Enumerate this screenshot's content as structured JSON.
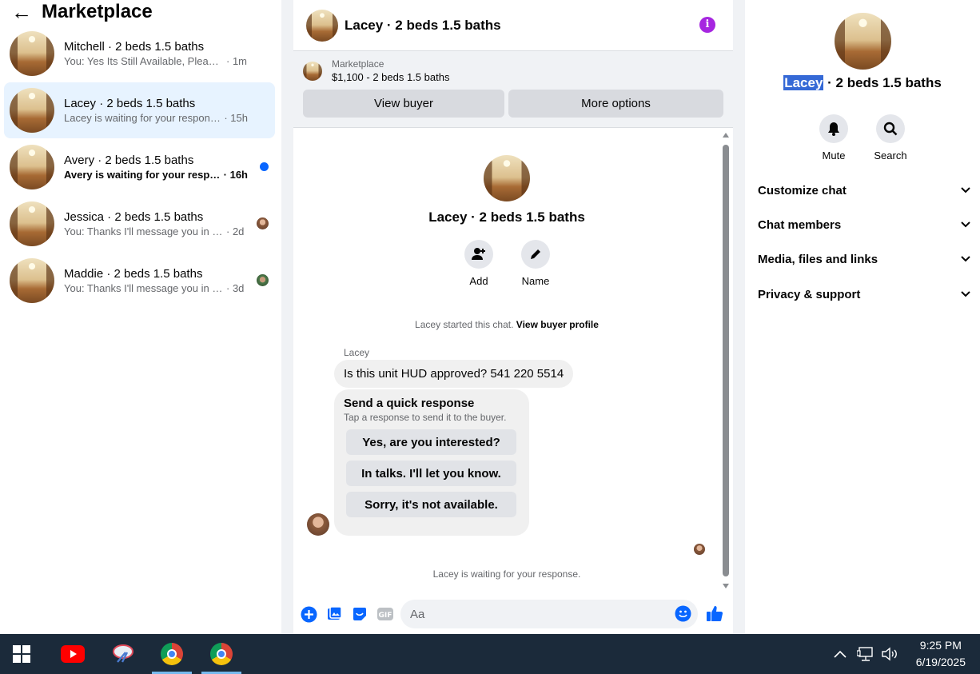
{
  "left": {
    "title": "Marketplace",
    "conversations": [
      {
        "name": "Mitchell · 2 beds 1.5 baths",
        "preview": "You: Yes Its Still Available, Please Sen...",
        "time": "· 1m"
      },
      {
        "name": "Lacey · 2 beds 1.5 baths",
        "preview": "Lacey is waiting for your response.",
        "time": "· 15h"
      },
      {
        "name": "Avery · 2 beds 1.5 baths",
        "preview": "Avery is waiting for your response.",
        "time": "· 16h"
      },
      {
        "name": "Jessica · 2 beds 1.5 baths",
        "preview": "You: Thanks I'll message you in a ...",
        "time": "· 2d"
      },
      {
        "name": "Maddie · 2 beds 1.5 baths",
        "preview": "You: Thanks I'll message you in a ...",
        "time": "· 3d"
      }
    ]
  },
  "chat": {
    "title": "Lacey · 2 beds 1.5 baths",
    "marketplace_label": "Marketplace",
    "listing": "$1,100 - 2 beds 1.5 baths",
    "view_buyer": "View buyer",
    "more_options": "More options",
    "intro_name": "Lacey · 2 beds 1.5 baths",
    "add_label": "Add",
    "name_label": "Name",
    "started_text": "Lacey started this chat.",
    "view_profile": "View buyer profile",
    "sender": "Lacey",
    "message": "Is this unit HUD approved? 541 220 5514",
    "quick_title": "Send a quick response",
    "quick_sub": "Tap a response to send it to the buyer.",
    "quick_responses": [
      "Yes, are you interested?",
      "In talks. I'll let you know.",
      "Sorry, it's not available."
    ],
    "waiting": "Lacey is waiting for your response.",
    "input_placeholder": "Aa"
  },
  "details": {
    "name_highlight": "Lacey",
    "name_rest": " · 2 beds 1.5 baths",
    "mute": "Mute",
    "search": "Search",
    "sections": [
      "Customize chat",
      "Chat members",
      "Media, files and links",
      "Privacy & support"
    ]
  },
  "taskbar": {
    "time": "9:25 PM",
    "date": "6/19/2025"
  },
  "colors": {
    "accent": "#0866ff",
    "info": "#a626e0",
    "active_row": "#e7f3ff",
    "highlight": "#3569d6"
  }
}
